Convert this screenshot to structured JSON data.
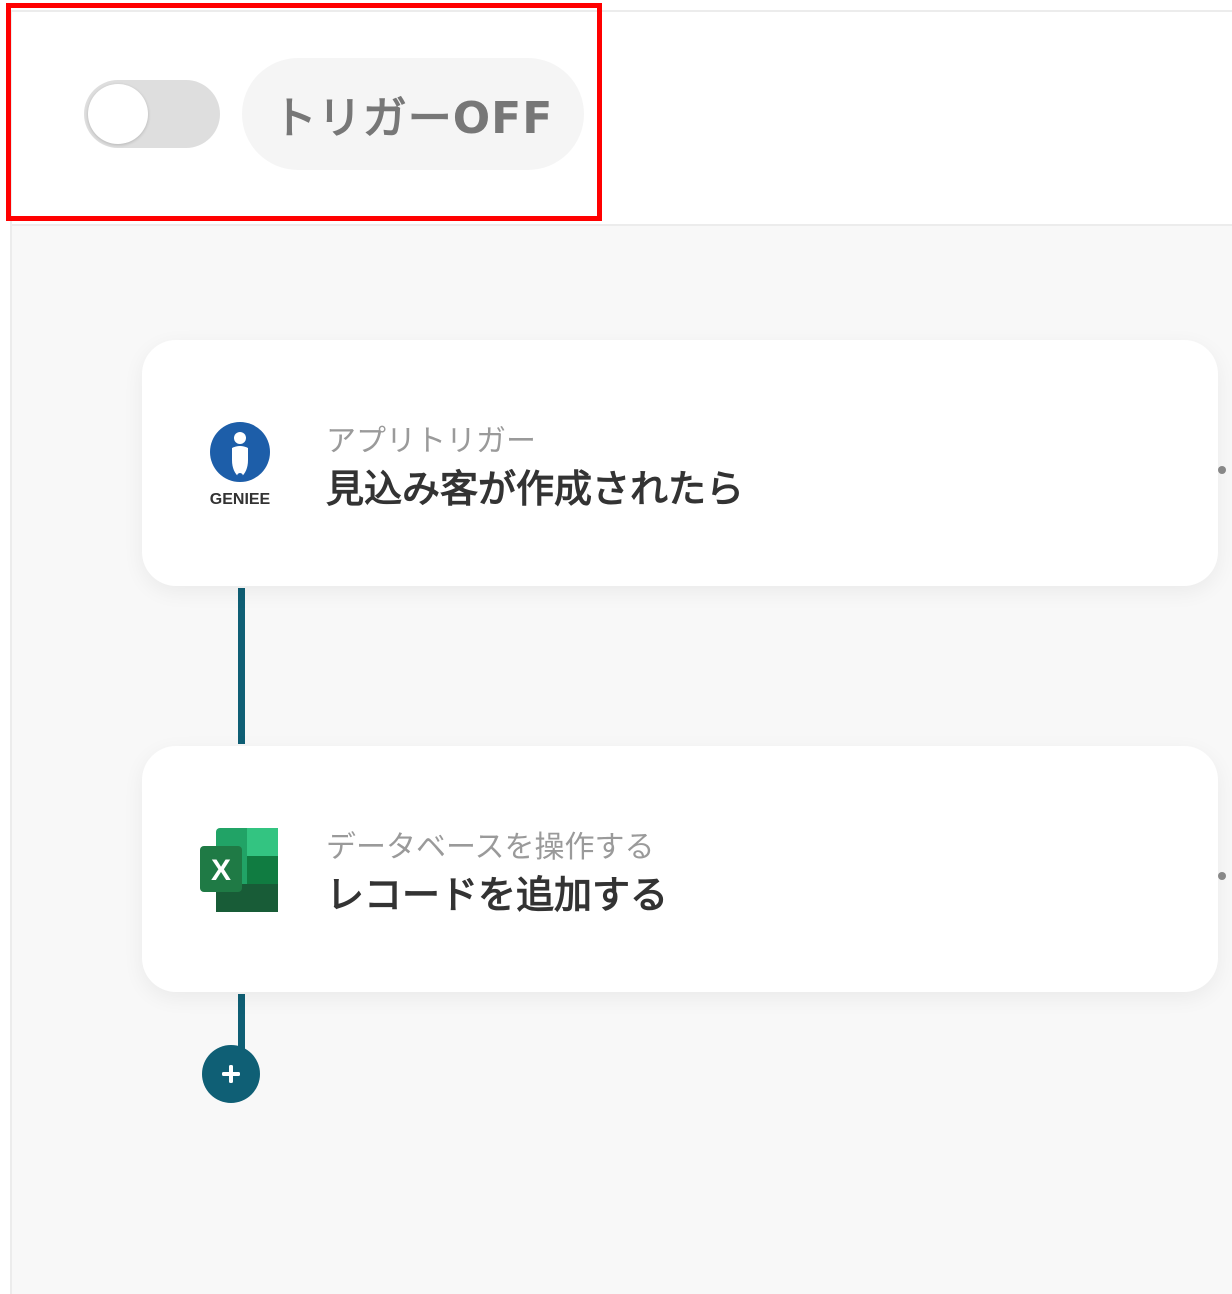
{
  "header": {
    "toggle_state": "off",
    "trigger_status_label": "トリガーOFF"
  },
  "flow": {
    "steps": [
      {
        "app_icon": "genee-icon",
        "app_logo_text": "GENIEE",
        "category": "アプリトリガー",
        "title": "見込み客が作成されたら"
      },
      {
        "app_icon": "excel-icon",
        "category": "データベースを操作する",
        "title": "レコードを追加する"
      }
    ],
    "add_step_icon": "plus-icon"
  },
  "colors": {
    "connector": "#0f5f75",
    "highlight": "#ff0000",
    "genee_blue": "#1d5ea9",
    "excel_green": "#1f7a45"
  }
}
